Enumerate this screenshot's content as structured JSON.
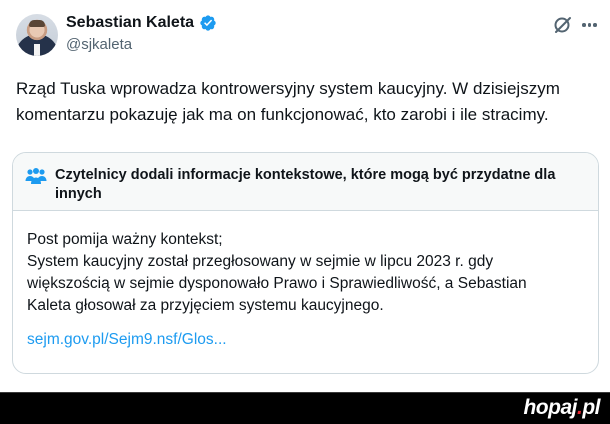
{
  "author": {
    "name": "Sebastian Kaleta",
    "handle": "@sjkaleta",
    "avatar_icon": "user-photo",
    "verified_icon": "verified-badge-icon"
  },
  "tweet": {
    "lines": [
      "Rząd Tuska wprowadza kontrowersyjny system kaucyjny. W dzisiejszym",
      "komentarzu pokazuję jak ma on funkcjonować, kto zarobi i ile stracimy."
    ]
  },
  "community_note": {
    "header_lines": [
      "Czytelnicy dodali informacje kontekstowe, które mogą być przydatne dla",
      "innych"
    ],
    "body_lines": [
      "Post pomija ważny kontekst;",
      "System kaucyjny został przegłosowany w sejmie w lipcu 2023 r. gdy",
      "większością w sejmie dysponowało Prawo i Sprawiedliwość, a Sebastian",
      "Kaleta głosował za przyjęciem systemu kaucyjnego."
    ],
    "link_text": "sejm.gov.pl/Sejm9.nsf/Glos..."
  },
  "watermark": {
    "text": "hopaj",
    "dot": ".",
    "suffix": "pl"
  },
  "colors": {
    "accent": "#1d9bf0",
    "text": "#0f1419",
    "muted": "#536471",
    "border": "#cfd9de",
    "brand_dot": "#e4202b"
  }
}
